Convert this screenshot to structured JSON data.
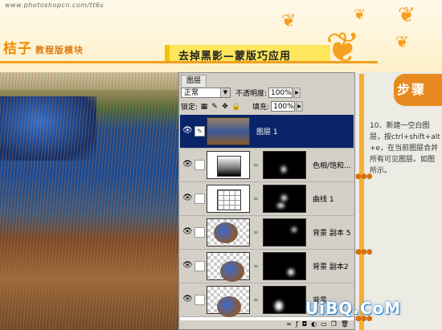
{
  "header": {
    "url": "www.photoshopcn.com/tt6s",
    "brand": "桔子",
    "brand_sub": "教程版模块",
    "title": "去掉黑影—蒙版巧应用"
  },
  "layers_panel": {
    "tab_label": "图层",
    "blend_mode": "正常",
    "opacity_label": "不透明度:",
    "opacity_value": "100%",
    "lock_label": "锁定:",
    "fill_label": "填充:",
    "fill_value": "100%",
    "layers": [
      {
        "name": "图层 1",
        "selected": true
      },
      {
        "name": "色相/饱和...",
        "selected": false
      },
      {
        "name": "曲线 1",
        "selected": false
      },
      {
        "name": "背景 副本 5",
        "selected": false
      },
      {
        "name": "背景 副本2",
        "selected": false
      },
      {
        "name": "背景",
        "selected": false
      }
    ]
  },
  "step": {
    "label": "步骤",
    "text": "10、新建一空白图层，按ctrl+shift+alt+e，在当前图层合并所有可见图层。如图所示。"
  },
  "watermark": "UiBQ.CoM",
  "colors": {
    "accent_orange": "#f08a00",
    "title_yellow": "#ffe65c",
    "selected_layer": "#0a246a"
  },
  "icons": [
    "eye-icon",
    "brush-icon",
    "chain-icon",
    "lock-icon",
    "butterfly-icon"
  ]
}
